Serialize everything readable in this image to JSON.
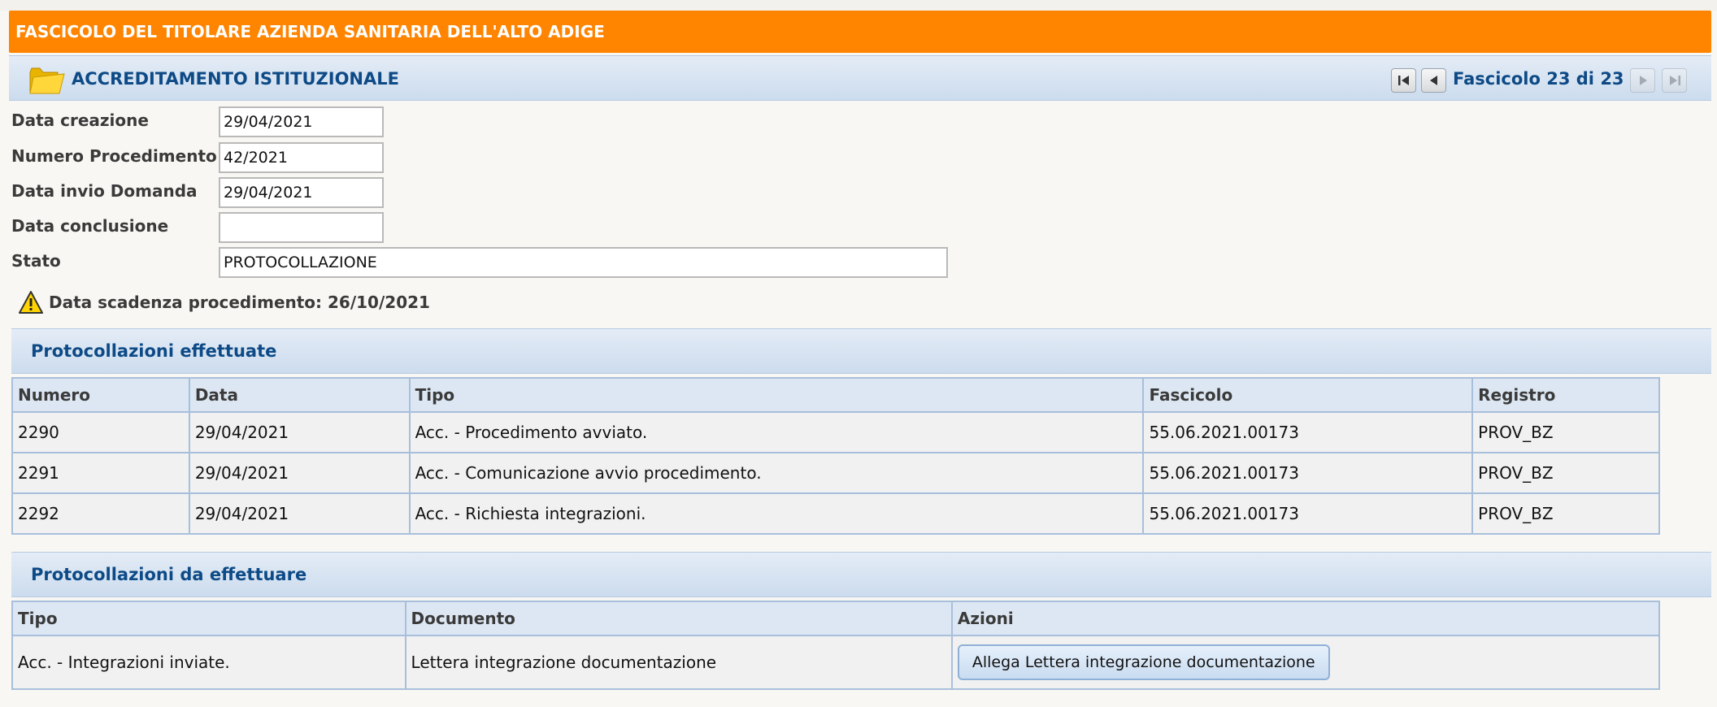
{
  "header": {
    "title": "FASCICOLO DEL TITOLARE AZIENDA SANITARIA DELL'ALTO ADIGE"
  },
  "subheader": {
    "title": "ACCREDITAMENTO ISTITUZIONALE",
    "counter": "Fascicolo 23 di 23"
  },
  "form": {
    "data_creazione": {
      "label": "Data creazione",
      "value": "29/04/2021"
    },
    "numero_procedimento": {
      "label": "Numero Procedimento",
      "value": "42/2021"
    },
    "data_invio": {
      "label": "Data invio Domanda",
      "value": "29/04/2021"
    },
    "data_conclusione": {
      "label": "Data conclusione",
      "value": ""
    },
    "stato": {
      "label": "Stato",
      "value": "PROTOCOLLAZIONE"
    }
  },
  "warning": {
    "text": "Data scadenza procedimento: 26/10/2021"
  },
  "effettuate": {
    "title": "Protocollazioni effettuate",
    "columns": [
      "Numero",
      "Data",
      "Tipo",
      "Fascicolo",
      "Registro"
    ],
    "rows": [
      [
        "2290",
        "29/04/2021",
        "Acc. - Procedimento avviato.",
        "55.06.2021.00173",
        "PROV_BZ"
      ],
      [
        "2291",
        "29/04/2021",
        "Acc. - Comunicazione avvio procedimento.",
        "55.06.2021.00173",
        "PROV_BZ"
      ],
      [
        "2292",
        "29/04/2021",
        "Acc. - Richiesta integrazioni.",
        "55.06.2021.00173",
        "PROV_BZ"
      ]
    ]
  },
  "da_effettuare": {
    "title": "Protocollazioni da effettuare",
    "columns": [
      "Tipo",
      "Documento",
      "Azioni"
    ],
    "rows": [
      {
        "tipo": "Acc. - Integrazioni inviate.",
        "documento": "Lettera integrazione documentazione",
        "azione": "Allega Lettera integrazione documentazione"
      }
    ]
  }
}
